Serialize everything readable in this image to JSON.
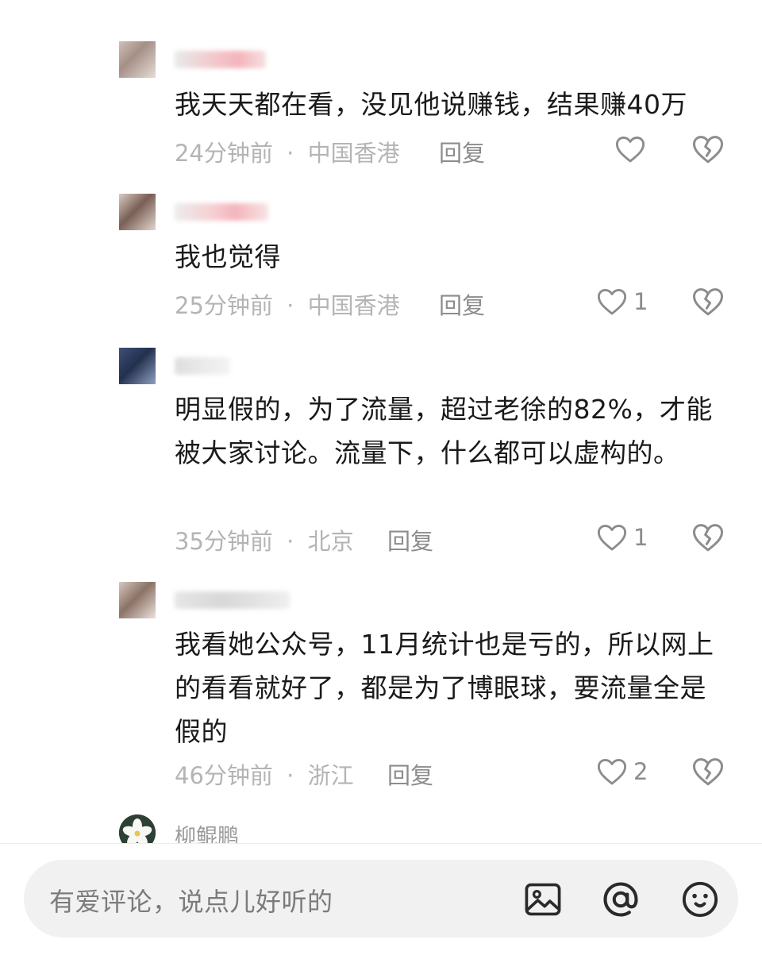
{
  "comments": [
    {
      "text": "我天天都在看，没见他说赚钱，结果赚40万",
      "time": "24分钟前",
      "location": "中国香港",
      "reply_label": "回复",
      "likes": ""
    },
    {
      "text": "我也觉得",
      "time": "25分钟前",
      "location": "中国香港",
      "reply_label": "回复",
      "likes": "1"
    },
    {
      "text": "明显假的，为了流量，超过老徐的82%，才能被大家讨论。流量下，什么都可以虚构的。",
      "time": "35分钟前",
      "location": "北京",
      "reply_label": "回复",
      "likes": "1"
    },
    {
      "text": "我看她公众号，11月统计也是亏的，所以网上的看看就好了，都是为了博眼球，要流量全是假的",
      "time": "46分钟前",
      "location": "浙江",
      "reply_label": "回复",
      "likes": "2"
    }
  ],
  "next_comment": {
    "username": "柳鲲鹏"
  },
  "separator": "·",
  "input": {
    "placeholder": "有爱评论，说点儿好听的"
  },
  "icons": {
    "like": "heart-outline-icon",
    "dislike": "broken-heart-icon",
    "image": "image-icon",
    "mention": "at-icon",
    "emoji": "smiley-icon"
  },
  "colors": {
    "text": "#1a1a1a",
    "meta": "#b4b4b4",
    "action": "#8c8c8c",
    "input_bg": "#f1f1f1"
  }
}
